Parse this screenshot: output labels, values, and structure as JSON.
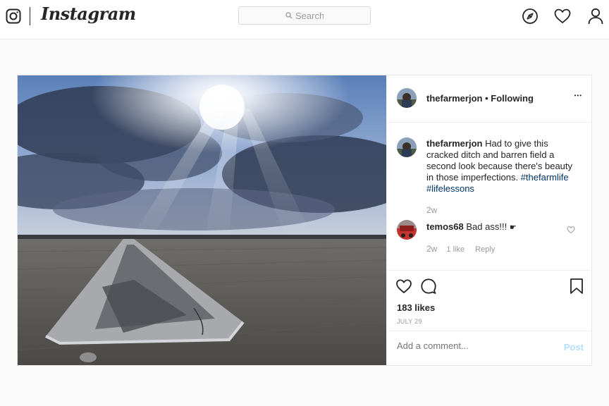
{
  "brand": {
    "wordmark": "Instagram"
  },
  "search": {
    "placeholder": "Search"
  },
  "nav_icons": [
    "compass-icon",
    "heart-icon",
    "person-icon"
  ],
  "post": {
    "username": "thefarmerjon",
    "separator": "•",
    "following": "Following",
    "more": "•••",
    "caption": {
      "username": "thefarmerjon",
      "text": "Had to give this cracked ditch and barren field a second look because there's beauty in those imperfections.",
      "tags": [
        "#thefarmlife",
        "#lifelessons"
      ],
      "time": "2w"
    },
    "comment": {
      "username": "temos68",
      "text": "Bad ass!!!",
      "time": "2w",
      "likes": "1 like",
      "reply": "Reply"
    },
    "likes": "183 likes",
    "date": "JULY 29",
    "comment_placeholder": "Add a comment...",
    "post_button": "Post"
  },
  "colors": {
    "link": "#003569",
    "post_button": "#b2dffc",
    "border": "#e6e6e6"
  }
}
